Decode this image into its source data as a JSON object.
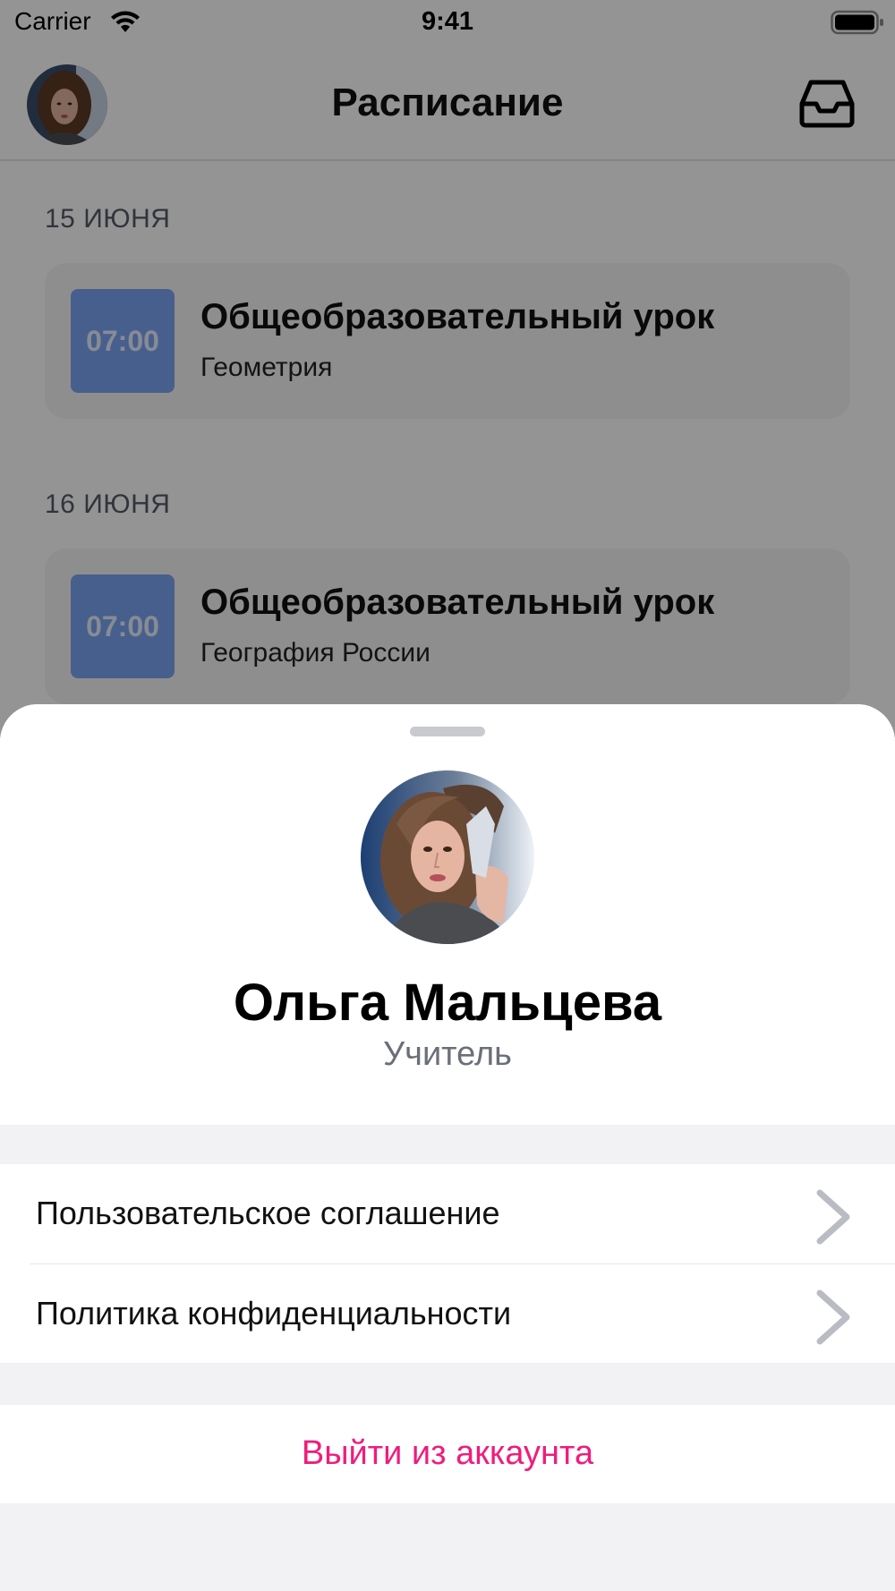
{
  "status_bar": {
    "carrier": "Carrier",
    "time": "9:41"
  },
  "nav": {
    "title": "Расписание",
    "right_icon": "inbox-icon"
  },
  "schedule": [
    {
      "date": "15 ИЮНЯ",
      "time": "07:00",
      "title": "Общеобразовательный урок",
      "subject": "Геометрия"
    },
    {
      "date": "16 ИЮНЯ",
      "time": "07:00",
      "title": "Общеобразовательный урок",
      "subject": "География России"
    }
  ],
  "profile": {
    "name": "Ольга Мальцева",
    "role": "Учитель"
  },
  "menu": {
    "items": [
      {
        "label": "Пользовательское соглашение",
        "icon": "chevron-right-icon"
      },
      {
        "label": "Политика конфиденциальности",
        "icon": "chevron-right-icon"
      }
    ],
    "logout_label": "Выйти из аккаунта"
  },
  "colors": {
    "accent": "#ef1d7d",
    "time_badge": "#7aa4f2",
    "overlay": "rgba(0,0,0,0.42)"
  }
}
